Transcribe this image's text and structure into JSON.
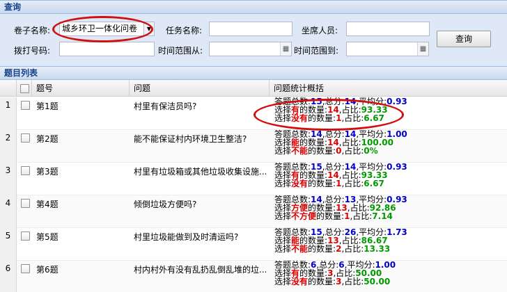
{
  "query": {
    "header": "查询",
    "paper_label": "卷子名称:",
    "paper_value": "城乡环卫一体化问卷",
    "task_label": "任务名称:",
    "agent_label": "坐席人员:",
    "phone_label": "拨打号码:",
    "time_from_label": "时间范围从:",
    "time_to_label": "时间范围到:",
    "search_button": "查询"
  },
  "list": {
    "header": "题目列表",
    "columns": {
      "number": "题号",
      "question": "问题",
      "stats": "问题统计概括"
    },
    "rows": [
      {
        "idx": "1",
        "num": "第1题",
        "q": "村里有保洁员吗?",
        "total": "15",
        "sum": "14",
        "avg": "0.93",
        "opt_a": "有",
        "cnt_a": "14",
        "pct_a": "93.33",
        "opt_b": "没有",
        "cnt_b": "1",
        "pct_b": "6.67"
      },
      {
        "idx": "2",
        "num": "第2题",
        "q": "能不能保证村内环境卫生整洁?",
        "total": "14",
        "sum": "14",
        "avg": "1.00",
        "opt_a": "能",
        "cnt_a": "14",
        "pct_a": "100.00",
        "opt_b": "不能",
        "cnt_b": "0",
        "pct_b": "0%"
      },
      {
        "idx": "3",
        "num": "第3题",
        "q": "村里有垃圾箱或其他垃圾收集设施...",
        "total": "15",
        "sum": "14",
        "avg": "0.93",
        "opt_a": "有",
        "cnt_a": "14",
        "pct_a": "93.33",
        "opt_b": "没有",
        "cnt_b": "1",
        "pct_b": "6.67"
      },
      {
        "idx": "4",
        "num": "第4题",
        "q": "倾倒垃圾方便吗?",
        "total": "14",
        "sum": "13",
        "avg": "0.93",
        "opt_a": "方便",
        "cnt_a": "13",
        "pct_a": "92.86",
        "opt_b": "不方便",
        "cnt_b": "1",
        "pct_b": "7.14"
      },
      {
        "idx": "5",
        "num": "第5题",
        "q": "村里垃圾能做到及时清运吗?",
        "total": "15",
        "sum": "26",
        "avg": "1.73",
        "opt_a": "能",
        "cnt_a": "13",
        "pct_a": "86.67",
        "opt_b": "不能",
        "cnt_b": "2",
        "pct_b": "13.33"
      },
      {
        "idx": "6",
        "num": "第6题",
        "q": "村内村外有没有乱扔乱倒乱堆的垃...",
        "total": "6",
        "sum": "6",
        "avg": "1.00",
        "opt_a": "有",
        "cnt_a": "3",
        "pct_a": "50.00",
        "opt_b": "没有",
        "cnt_b": "3",
        "pct_b": "50.00"
      }
    ]
  },
  "text": {
    "total_prefix": "答题总数:",
    "sum_prefix": ",总分:",
    "avg_prefix": ",平均分:",
    "choose": "选择",
    "count_suffix": "的数量:",
    "pct_prefix": ",占比:"
  },
  "colors": {
    "header_text": "#15428b",
    "query_bg": "#dfe8f6",
    "blue": "#0000cc",
    "red": "#dd0000",
    "green": "#009900",
    "highlight": "#d01010"
  }
}
